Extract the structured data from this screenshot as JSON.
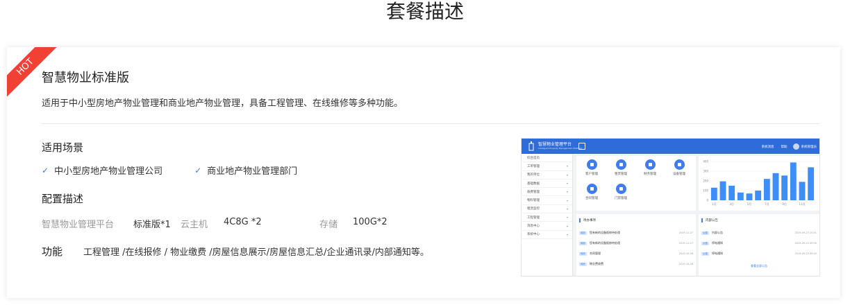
{
  "page": {
    "title": "套餐描述"
  },
  "card": {
    "badge": "HOT",
    "plan_name": "智慧物业标准版",
    "plan_description": "适用于中小型房地产物业管理和商业地产物业管理，具备工程管理、在线维修等多种功能。",
    "scenes_title": "适用场景",
    "scenes": [
      {
        "label": "中小型房地产物业管理公司"
      },
      {
        "label": "商业地产物业管理部门"
      }
    ],
    "config_title": "配置描述",
    "config": {
      "platform_label": "智慧物业管理平台",
      "platform_value": "标准版*1",
      "host_label": "云主机",
      "host_value": "4C8G *2",
      "storage_label": "存储",
      "storage_value": "100G*2"
    },
    "function_label": "功能",
    "function_text": "工程管理 /在线报修 / 物业缴费 /房屋信息展示/房屋信息汇总/企业通讯录/内部通知等。"
  },
  "screenshot": {
    "app_title": "智慧物业管理平台",
    "app_subtitle": "Intelligent Property Management Platform",
    "header_right": [
      "系统消息",
      "帮助",
      "系统管理员"
    ],
    "sidebar": [
      "综合首页",
      "工单管理",
      "我的单位",
      "基础数据",
      "收费管理",
      "物料管理",
      "租赁监控",
      "工程管理",
      "消息中心",
      "系统中心"
    ],
    "quick_icons": [
      "客户管理",
      "租赁管理",
      "财务管理",
      "设备管理",
      "合同管理",
      "门禁管理"
    ],
    "todo_title": "待办事项",
    "todo_items": [
      {
        "tag": "待办",
        "text": "您有新的设备报修待处理",
        "date": "2019-11-27"
      },
      {
        "tag": "待办",
        "text": "您有新的设备报修待处理",
        "date": "2019-11-27"
      },
      {
        "tag": "待办",
        "text": "合同管理",
        "date": "2019-10-28"
      },
      {
        "tag": "待办",
        "text": "物业费收费",
        "date": "2019-10-28"
      }
    ],
    "notice_title": "内部公告",
    "notice_items": [
      {
        "tag": "公告",
        "text": "内部公告",
        "date": "2019-09-23 15:41"
      },
      {
        "tag": "公告",
        "text": "停电通知",
        "date": "2019-09-23 09:00"
      },
      {
        "tag": "公告",
        "text": "停电通知",
        "date": "2019-09-23 09:00"
      }
    ],
    "notice_more": "查看全部公告",
    "chart_data": {
      "type": "bar",
      "categories": [
        "1月",
        "2月",
        "3月",
        "4月",
        "5月",
        "6月",
        "7月",
        "8月",
        "9月",
        "10月",
        "11月",
        "12月"
      ],
      "values": [
        130,
        195,
        150,
        80,
        70,
        100,
        220,
        280,
        255,
        390,
        190,
        340
      ],
      "ylim": [
        0,
        400
      ],
      "yticks": [
        0,
        100,
        200,
        300,
        400
      ],
      "xtick_labels": [
        "1月",
        "3月",
        "5月",
        "7月",
        "9月",
        "11月"
      ],
      "bar_color": "#3e8ef7"
    }
  }
}
